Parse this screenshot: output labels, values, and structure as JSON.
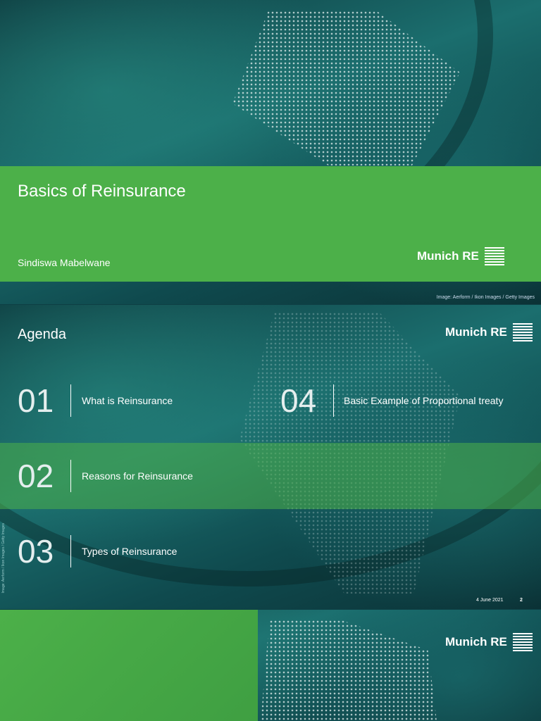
{
  "slide1": {
    "title": "Basics of Reinsurance",
    "author": "Sindiswa Mabelwane",
    "logo": "Munich RE",
    "credit": "Image: Aerform / Ikon Images / Getty Images"
  },
  "slide2": {
    "heading": "Agenda",
    "logo": "Munich RE",
    "items": [
      {
        "num": "01",
        "label": "What is Reinsurance"
      },
      {
        "num": "02",
        "label": "Reasons for Reinsurance"
      },
      {
        "num": "03",
        "label": "Types of Reinsurance"
      },
      {
        "num": "04",
        "label": "Basic Example of Proportional treaty"
      }
    ],
    "side_credit": "Image: Aerform / Ikon Images / Getty Images",
    "date": "4 June 2021",
    "page": "2"
  },
  "slide3": {
    "logo": "Munich RE"
  },
  "colors": {
    "green": "#4cb049",
    "teal": "#1b6e6e"
  }
}
